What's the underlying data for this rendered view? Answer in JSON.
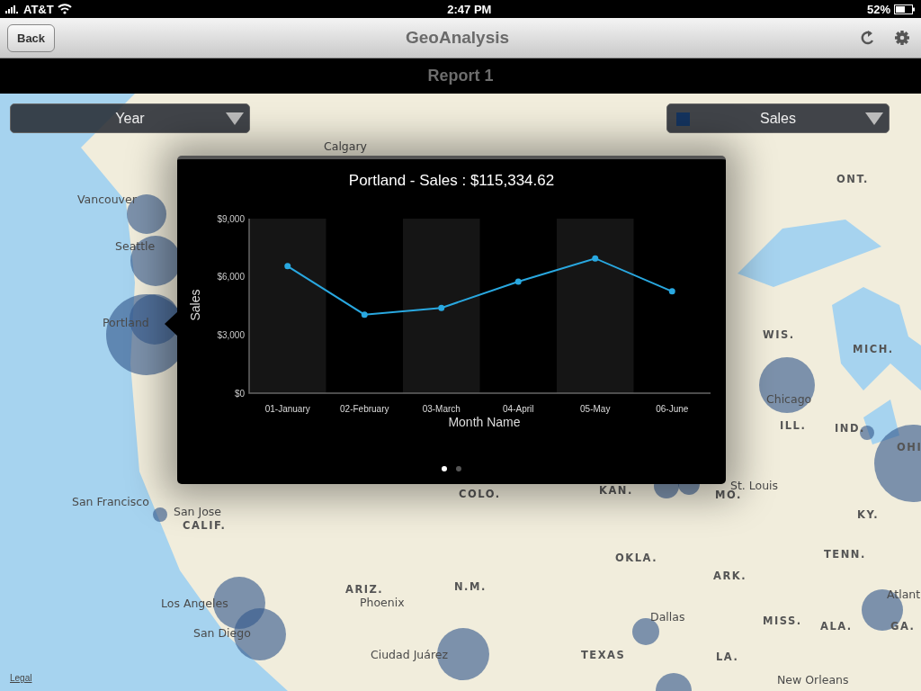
{
  "status_bar": {
    "carrier": "AT&T",
    "time": "2:47 PM",
    "battery": "52%"
  },
  "nav_bar": {
    "back": "Back",
    "title": "GeoAnalysis"
  },
  "report_bar": {
    "title": "Report 1"
  },
  "selectors": [
    {
      "label": "Year",
      "kind": "plain"
    },
    {
      "label": "Sales",
      "kind": "swatch"
    }
  ],
  "map_labels": [
    {
      "text": "Calgary",
      "kind": "city"
    },
    {
      "text": "Vancouver",
      "kind": "city"
    },
    {
      "text": "Seattle",
      "kind": "city"
    },
    {
      "text": "Portland",
      "kind": "city"
    },
    {
      "text": "San Francisco",
      "kind": "city"
    },
    {
      "text": "San Jose",
      "kind": "city"
    },
    {
      "text": "CALIF.",
      "kind": "region"
    },
    {
      "text": "Los Angeles",
      "kind": "city"
    },
    {
      "text": "San Diego",
      "kind": "city"
    },
    {
      "text": "ARIZ.",
      "kind": "region"
    },
    {
      "text": "Phoenix",
      "kind": "city"
    },
    {
      "text": "N.M.",
      "kind": "region"
    },
    {
      "text": "Ciudad Juárez",
      "kind": "city"
    },
    {
      "text": "COLO.",
      "kind": "region"
    },
    {
      "text": "KAN.",
      "kind": "region"
    },
    {
      "text": "OKLA.",
      "kind": "region"
    },
    {
      "text": "TEXAS",
      "kind": "region"
    },
    {
      "text": "Dallas",
      "kind": "city"
    },
    {
      "text": "ONT.",
      "kind": "region"
    },
    {
      "text": "WIS.",
      "kind": "region"
    },
    {
      "text": "MICH.",
      "kind": "region"
    },
    {
      "text": "Chicago",
      "kind": "city"
    },
    {
      "text": "ILL.",
      "kind": "region"
    },
    {
      "text": "IND.",
      "kind": "region"
    },
    {
      "text": "OHI",
      "kind": "region"
    },
    {
      "text": "St. Louis",
      "kind": "city"
    },
    {
      "text": "MO.",
      "kind": "region"
    },
    {
      "text": "KY.",
      "kind": "region"
    },
    {
      "text": "TENN.",
      "kind": "region"
    },
    {
      "text": "ARK.",
      "kind": "region"
    },
    {
      "text": "MISS.",
      "kind": "region"
    },
    {
      "text": "ALA.",
      "kind": "region"
    },
    {
      "text": "Atlant",
      "kind": "city"
    },
    {
      "text": "GA.",
      "kind": "region"
    },
    {
      "text": "LA.",
      "kind": "region"
    },
    {
      "text": "New Orleans",
      "kind": "city"
    }
  ],
  "legal_link": "Legal",
  "popup": {
    "title": "Portland - Sales : $115,334.62",
    "chart_data": {
      "type": "line",
      "xlabel": "Month Name",
      "ylabel": "Sales",
      "categories": [
        "01-January",
        "02-February",
        "03-March",
        "04-April",
        "05-May",
        "06-June"
      ],
      "series": [
        {
          "marker": "circle",
          "color": "#29a8e0",
          "values": [
            6550,
            4050,
            4400,
            5750,
            6950,
            5250
          ]
        }
      ],
      "ylim": [
        0,
        9000
      ],
      "yticks": [
        {
          "value": 0,
          "label": "$0"
        },
        {
          "value": 3000,
          "label": "$3,000"
        },
        {
          "value": 6000,
          "label": "$6,000"
        },
        {
          "value": 9000,
          "label": "$9,000"
        }
      ]
    },
    "pages": [
      {
        "selected": true
      },
      {
        "selected": false
      }
    ]
  }
}
